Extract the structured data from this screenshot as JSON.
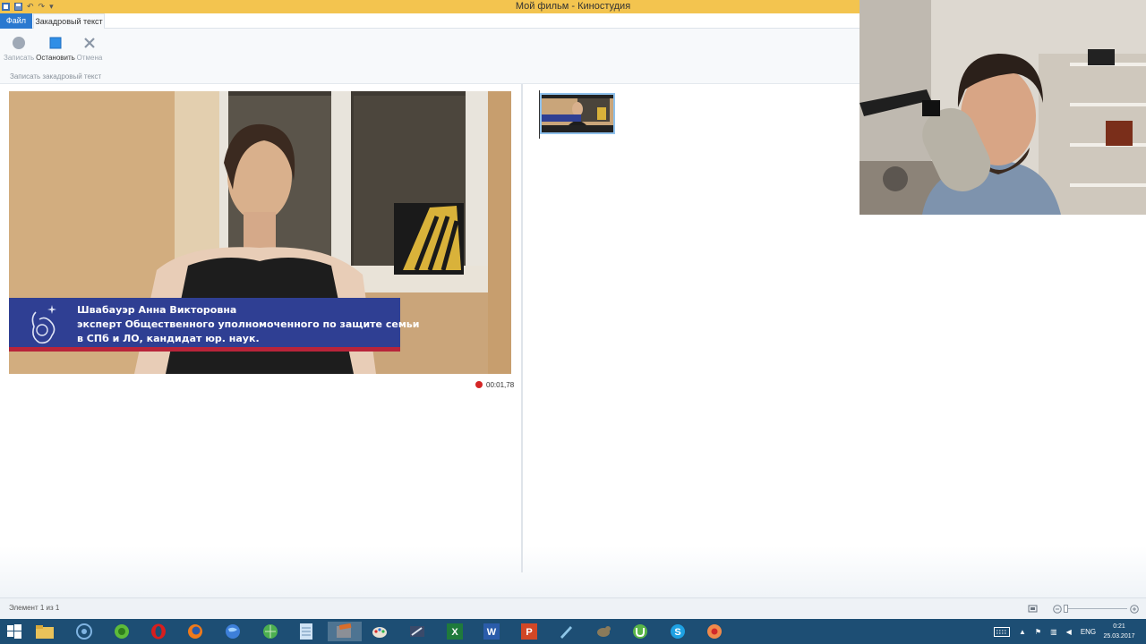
{
  "window": {
    "title": "Мой фильм - Киностудия",
    "qat_icons": [
      "save-icon",
      "undo-icon",
      "redo-icon",
      "qat-dropdown-icon"
    ]
  },
  "ribbon": {
    "file_tab": "Файл",
    "active_tab": "Закадровый текст",
    "record_label": "Записать",
    "stop_label": "Остановить",
    "cancel_label": "Отмена",
    "group_label": "Записать закадровый текст"
  },
  "preview": {
    "caption_line1": "Швабауэр Анна Викторовна",
    "caption_line2": "эксперт Общественного уполномоченного по защите семьи",
    "caption_line3": "в СПб и ЛО, кандидат юр. наук.",
    "record_time": "00:01,78"
  },
  "status": {
    "element_text": "Элемент 1 из 1"
  },
  "taskbar": {
    "apps": [
      "start-icon",
      "file-explorer-icon",
      "media-icon",
      "green-app-icon",
      "opera-icon",
      "firefox-icon",
      "globe-icon",
      "browser-icon",
      "notepad-icon",
      "movie-maker-icon",
      "paint-icon",
      "tools-icon",
      "excel-icon",
      "word-icon",
      "powerpoint-icon",
      "pen-icon",
      "animal-app-icon",
      "utorrent-icon",
      "skype-icon",
      "recorder-icon"
    ],
    "language": "ENG",
    "time": "0:21",
    "date": "25.03.2017"
  },
  "colors": {
    "titlebar": "#f3c44f",
    "file_tab": "#2b79d0",
    "taskbar": "#1d4e74",
    "record_dot": "#d42626",
    "caption_banner": "#2f3f93"
  }
}
